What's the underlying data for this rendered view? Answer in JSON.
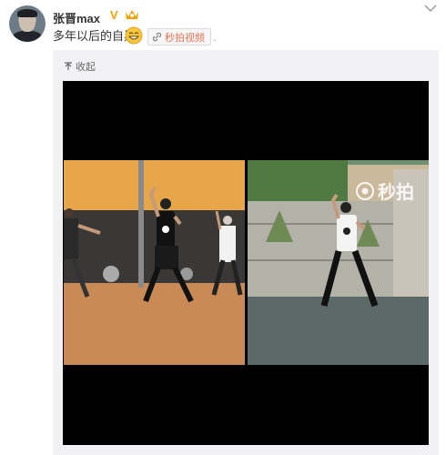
{
  "post": {
    "username": "张晋max",
    "text": "多年以后的自黑",
    "video_link_label": "秒拍视频",
    "trailing_dot": "."
  },
  "media": {
    "collapse_label": "收起",
    "watermark_text": "秒拍"
  },
  "colors": {
    "accent": "#eb7350",
    "verified": "#f5a000",
    "card_bg": "#f2f2f5"
  }
}
